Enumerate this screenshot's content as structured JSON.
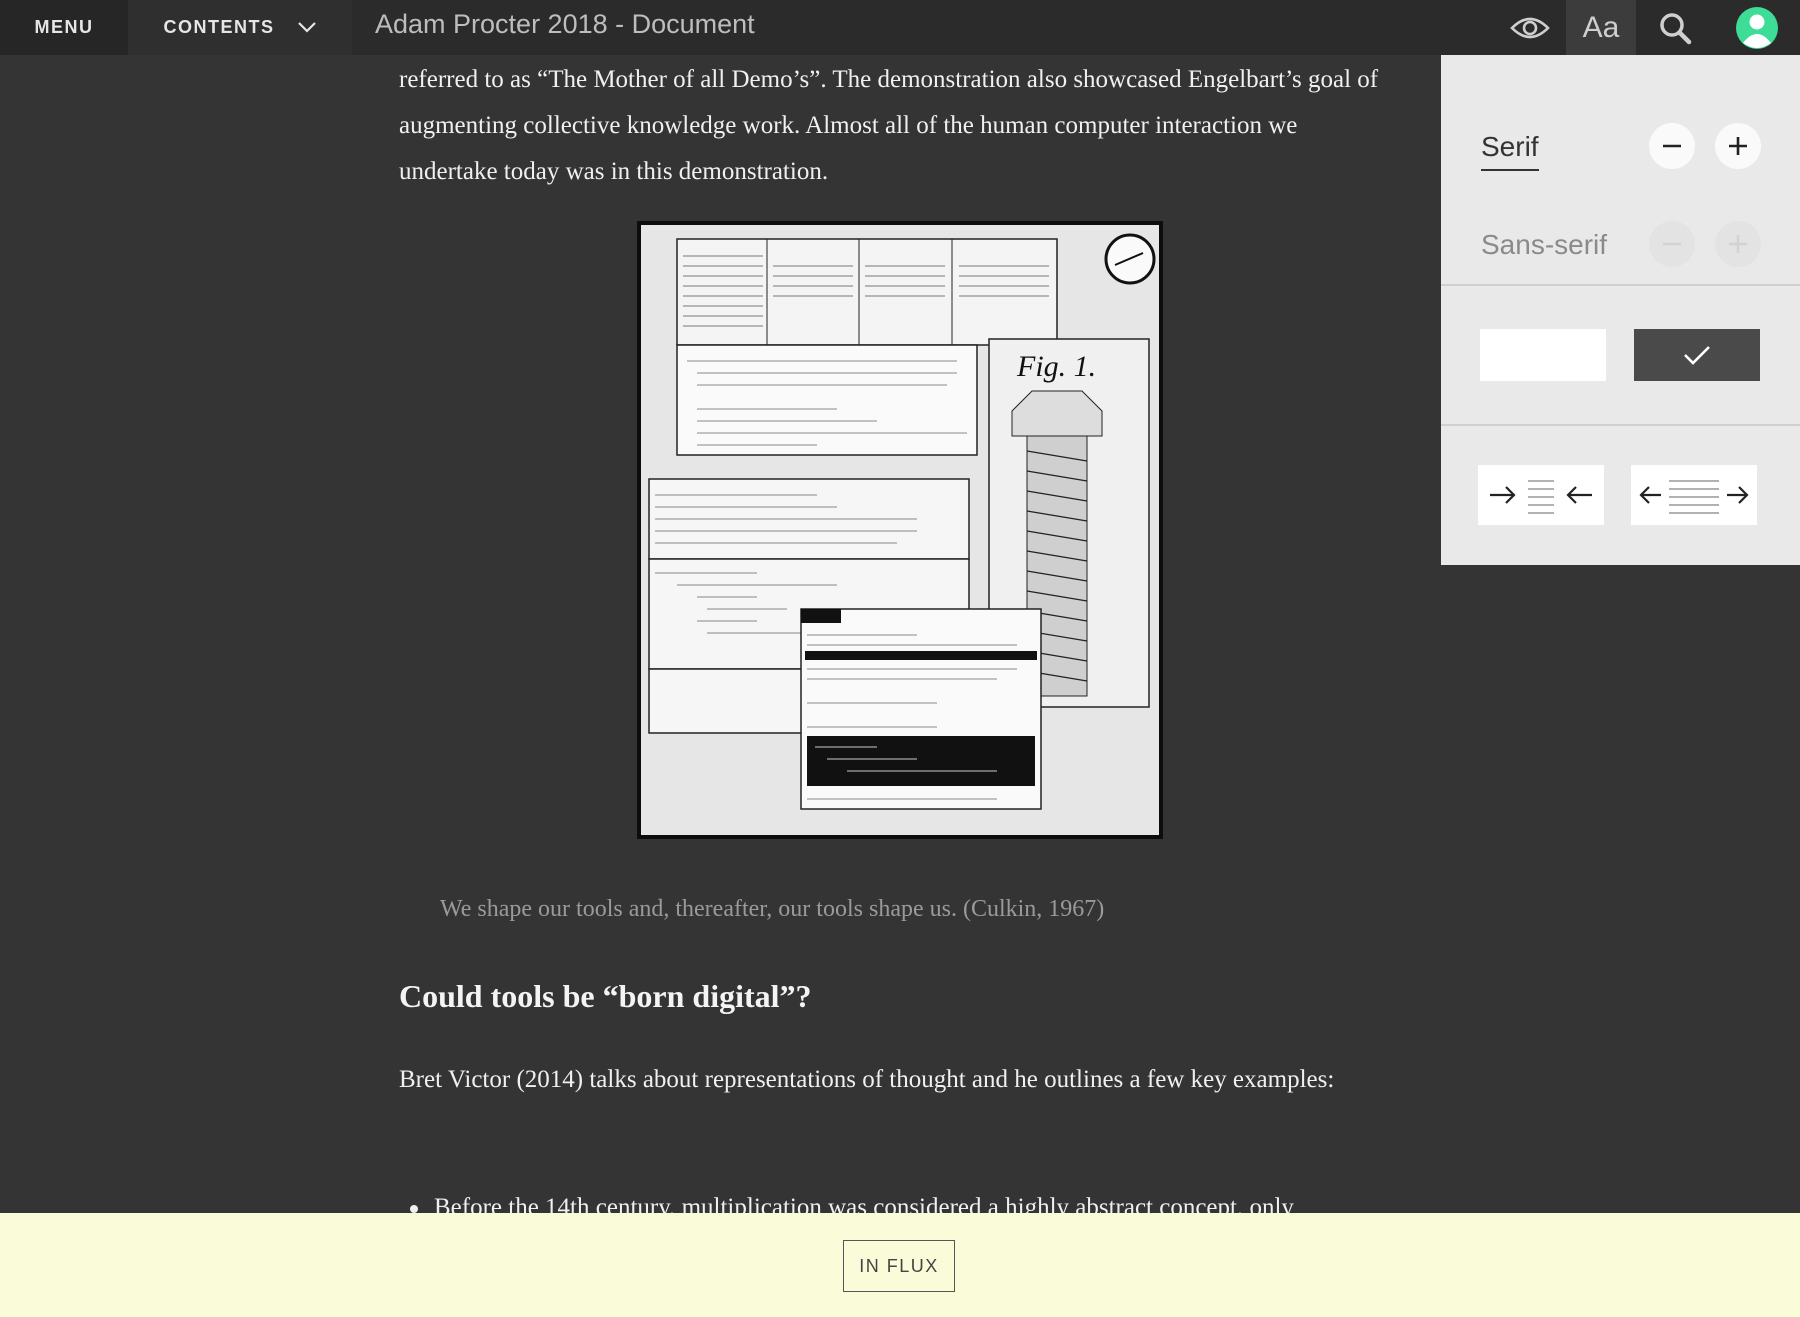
{
  "topbar": {
    "menu_label": "MENU",
    "contents_label": "CONTENTS",
    "document_title": "Adam Procter 2018 - Document",
    "font_settings_label": "Aa"
  },
  "document": {
    "intro_paragraph": "referred to as “The Mother of all Demo’s”. The demonstration also showcased Engelbart’s goal of augmenting collective knowledge work. Almost all of the human computer interaction we undertake today was in this demonstration.",
    "figure_label": "Fig. 1.",
    "caption": "We shape our tools and, thereafter, our tools shape us. (Culkin, 1967)",
    "heading": "Could tools be “born digital”?",
    "paragraph_2": "Bret Victor (2014) talks about representations of thought and he outlines a few key examples:",
    "bullet_1": "Before the 14th century, multiplication was considered a highly abstract concept, only"
  },
  "settings_panel": {
    "font_serif": "Serif",
    "font_sans": "Sans-serif",
    "selected_font": "Serif",
    "selected_theme": "dark"
  },
  "footer": {
    "status_label": "IN FLUX"
  },
  "colors": {
    "page_background": "#343434",
    "topbar_background": "#2b2b2b",
    "panel_background": "#e9e9e9",
    "footer_background": "#f9fbd9",
    "avatar": "#3ddc97"
  }
}
